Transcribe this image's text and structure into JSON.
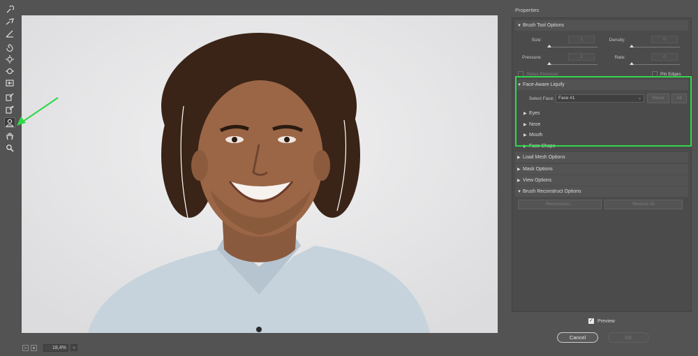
{
  "zoom": {
    "value": "18,4%",
    "minus": "−",
    "plus": "+",
    "dropdown": "⌄"
  },
  "properties": {
    "title": "Properties",
    "brush_tool": {
      "header": "Brush Tool Options",
      "size_label": "Size:",
      "size_value": "1",
      "density_label": "Density:",
      "density_value": "0",
      "pressure_label": "Pressure:",
      "pressure_value": "1",
      "rate_label": "Rate:",
      "rate_value": "0",
      "stylus_label": "Stylus Pressure",
      "pin_label": "Pin Edges"
    },
    "face_aware": {
      "header": "Face-Aware Liquify",
      "select_face_label": "Select Face:",
      "select_face_value": "Face #1",
      "reset_label": "Reset",
      "all_label": "All",
      "eyes": "Eyes",
      "nose": "Nose",
      "mouth": "Mouth",
      "face_shape": "Face Shape"
    },
    "load_mesh": "Load Mesh Options",
    "mask": "Mask Options",
    "view": "View Options",
    "brush_reconstruct": "Brush Reconstruct Options",
    "reconstruct_label": "Reconstruct...",
    "restore_label": "Restore All"
  },
  "preview_label": "Preview",
  "preview_checked": true,
  "cancel_label": "Cancel",
  "ok_label": "OK",
  "colors": {
    "highlight": "#32d74b",
    "arrow": "#32d74b"
  }
}
